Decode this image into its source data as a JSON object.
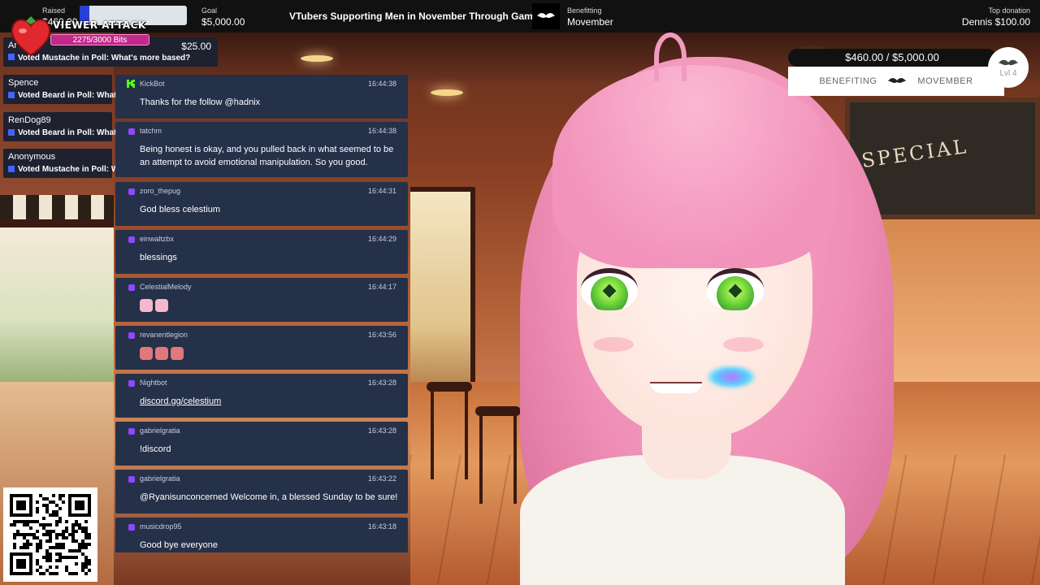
{
  "topbar": {
    "raised_label": "Raised",
    "raised_value": "$460.00",
    "goal_label": "Goal",
    "goal_value": "$5,000.00",
    "campaign_title": "VTubers Supporting Men in November Through Gaming",
    "benefitting_label": "Benefitting",
    "benefitting_value": "Movember",
    "top_donation_label": "Top donation",
    "top_donation_value": "Dennis $100.00",
    "raised_fraction": 0.092
  },
  "viewer_attack": {
    "title": "VIEWER ATTACK",
    "bits": "2275/3000 Bits"
  },
  "poll_alerts": [
    {
      "name": "Ar",
      "message": "Voted Mustache in Poll: What's more based?",
      "amount": "$25.00"
    },
    {
      "name": "Spence",
      "message": "Voted Beard in Poll: What"
    },
    {
      "name": "RenDog89",
      "message": "Voted Beard in Poll: What"
    },
    {
      "name": "Anonymous",
      "message": "Voted Mustache in Poll: W"
    }
  ],
  "chat": [
    {
      "user": "KickBot",
      "time": "16:44:38",
      "text": "Thanks for the follow @hadnix",
      "badge": "kick"
    },
    {
      "user": "tatchm",
      "time": "16:44:38",
      "text": "Being honest is okay, and you pulled back in what seemed to be an attempt to avoid emotional manipulation. So you good.",
      "badge": "twitch"
    },
    {
      "user": "zoro_thepug",
      "time": "16:44:31",
      "text": "God bless celestium",
      "badge": "twitch"
    },
    {
      "user": "einwaltzbx",
      "time": "16:44:29",
      "text": "blessings",
      "badge": "twitch"
    },
    {
      "user": "CelestialMelody",
      "time": "16:44:17",
      "text": "",
      "badge": "twitch",
      "emotes": 2
    },
    {
      "user": "revanentlegion",
      "time": "16:43:56",
      "text": "",
      "badge": "twitch",
      "emotes": 3
    },
    {
      "user": "Nightbot",
      "time": "16:43:28",
      "text": "discord.gg/celestium",
      "badge": "twitch",
      "link": true
    },
    {
      "user": "gabrielgratia",
      "time": "16:43:28",
      "text": "!discord",
      "badge": "twitch"
    },
    {
      "user": "gabrielgratia",
      "time": "16:43:22",
      "text": "@Ryanisunconcerned Welcome in, a blessed Sunday to be sure!",
      "badge": "twitch"
    },
    {
      "user": "musicdrop95",
      "time": "16:43:18",
      "text": "Good bye everyone",
      "badge": "twitch"
    }
  ],
  "goal_widget": {
    "progress_text": "$460.00 / $5,000.00",
    "benefiting_label": "BENEFITING",
    "benefiting_org": "MOVEMBER",
    "level_text": "Lvl 4",
    "progress_fraction": 0.092
  },
  "background": {
    "chalkboard_text": "SPECIAL"
  },
  "colors": {
    "chat_bg": "#253049",
    "twitch_badge": "#9147ff",
    "kick_badge": "#53fc18",
    "bits_bar": "#c02b8a"
  }
}
